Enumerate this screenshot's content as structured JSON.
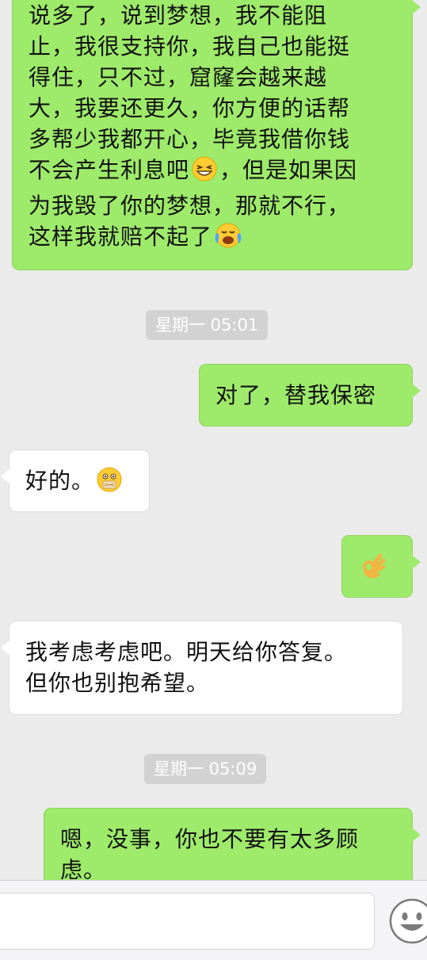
{
  "messages": [
    {
      "side": "me",
      "text": "说多了，说到梦想，我不能阻止，我很支持你，我自己也能挺得住，只不过，窟窿会越来越大，我要还更久，你方便的话帮多帮少我都开心，毕竟我借你钱不会产生利息吧😆，但是如果因为我毁了你的梦想，那就不行，这样我就赔不起了😭"
    },
    {
      "side": "me",
      "text": "对了，替我保密"
    },
    {
      "side": "them",
      "text": "好的。🤐"
    },
    {
      "side": "me",
      "text": "👌"
    },
    {
      "side": "them",
      "text": "我考虑考虑吧。明天给你答复。但你也别抱希望。"
    },
    {
      "side": "me",
      "text": "嗯，没事，你也不要有太多顾虑。"
    }
  ],
  "chat": {
    "msg1_lines": [
      "说多了，说到梦想，我不能阻",
      "止，我很支持你，我自己也能挺",
      "得住，只不过，窟窿会越来越",
      "大，我要还更久，你方便的话帮",
      "多帮少我都开心，毕竟我借你钱",
      "不会产生利息吧",
      "，但是如果因",
      "为我毁了你的梦想，那就不行，",
      "这样我就赔不起了"
    ],
    "msg2": "对了，替我保密",
    "msg3": "好的。",
    "msg5_lines": [
      "我考虑考虑吧。明天给你答复。",
      "但你也别抱希望。"
    ],
    "msg6_lines": [
      "嗯，没事，你也不要有太多顾",
      "虑。"
    ]
  },
  "timestamps": [
    "星期一 05:01",
    "星期一 05:09"
  ],
  "emojis": {
    "grin_squint": "grinning-squinting-face-icon",
    "sob": "loudly-crying-face-icon",
    "zipper": "zipper-mouth-face-icon",
    "ok_hand": "ok-hand-icon",
    "smiley_button": "smiley-face-icon"
  },
  "colors": {
    "background": "#ebebeb",
    "sent_bubble": "#9eea6a",
    "received_bubble": "#ffffff",
    "timestamp_bg": "#d2d2d2"
  }
}
